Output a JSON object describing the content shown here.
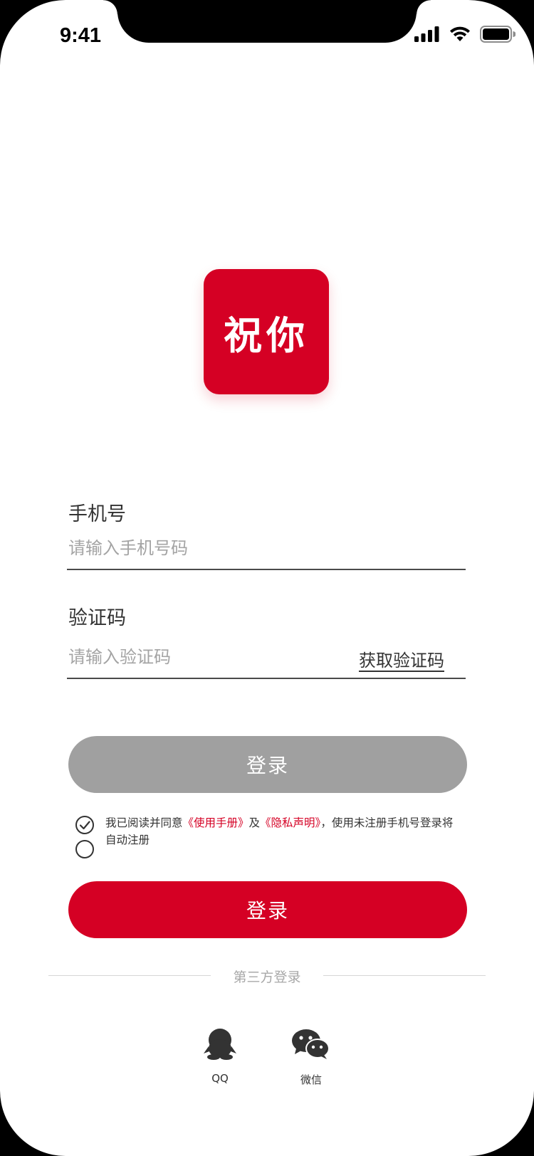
{
  "status_bar": {
    "time": "9:41"
  },
  "logo": {
    "text": "祝你",
    "color": "#d50024"
  },
  "form": {
    "phone": {
      "label": "手机号",
      "placeholder": "请输入手机号码"
    },
    "code": {
      "label": "验证码",
      "placeholder": "请输入验证码",
      "get_code_label": "获取验证码"
    }
  },
  "buttons": {
    "login_disabled_label": "登录",
    "login_label": "登录",
    "disabled_color": "#a0a0a0",
    "primary_color": "#d50024"
  },
  "agreement": {
    "prefix": "我已阅读并同意",
    "manual_link": "《使用手册》",
    "and": "及",
    "privacy_link": "《隐私声明》",
    "suffix": "，使用未注册手机号登录将自动注册"
  },
  "third_party": {
    "title": "第三方登录",
    "options": [
      {
        "label": "QQ",
        "icon": "qq-penguin-icon"
      },
      {
        "label": "微信",
        "icon": "wechat-icon"
      }
    ]
  }
}
